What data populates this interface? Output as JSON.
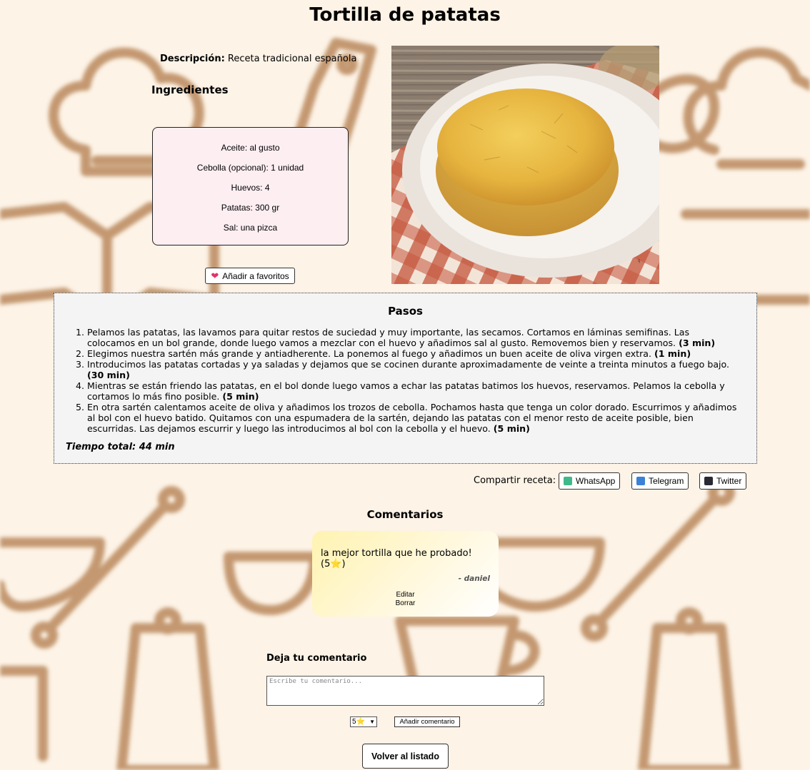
{
  "recipe": {
    "title": "Tortilla de patatas",
    "description_label": "Descripción:",
    "description": "Receta tradicional española",
    "ingredients_title": "Ingredientes",
    "ingredients": [
      "Aceite: al gusto",
      "Cebolla (opcional): 1 unidad",
      "Huevos: 4",
      "Patatas: 300 gr",
      "Sal: una pizca"
    ],
    "favorite_icon": "heart-icon",
    "favorite_label": "Añadir a favoritos"
  },
  "steps": {
    "title": "Pasos",
    "items": [
      {
        "text": "Pelamos las patatas, las lavamos para quitar restos de suciedad y muy importante, las secamos. Cortamos en láminas semifinas. Las colocamos en un bol grande, donde luego vamos a mezclar con el huevo y añadimos sal al gusto. Removemos bien y reservamos.",
        "time": "(3 min)"
      },
      {
        "text": "Elegimos nuestra sartén más grande y antiadherente. La ponemos al fuego y añadimos un buen aceite de oliva virgen extra.",
        "time": "(1 min)"
      },
      {
        "text": "Introducimos las patatas cortadas y ya saladas y dejamos que se cocinen durante aproximadamente de veinte a treinta minutos a fuego bajo.",
        "time": "(30 min)"
      },
      {
        "text": "Mientras se están friendo las patatas, en el bol donde luego vamos a echar las patatas batimos los huevos, reservamos. Pelamos la cebolla y cortamos lo más fino posible.",
        "time": "(5 min)"
      },
      {
        "text": "En otra sartén calentamos aceite de oliva y añadimos los trozos de cebolla. Pochamos hasta que tenga un color dorado. Escurrimos y añadimos al bol con el huevo batido. Quitamos con una espumadera de la sartén, dejando las patatas con el menor resto de aceite posible, bien escurridas. Las dejamos escurrir y luego las introducimos al bol con la cebolla y el huevo.",
        "time": "(5 min)"
      }
    ],
    "total_time": "Tiempo total: 44 min"
  },
  "share": {
    "label": "Compartir receta:",
    "buttons": [
      {
        "label": "WhatsApp",
        "color": "#3fb98a"
      },
      {
        "label": "Telegram",
        "color": "#3b82d6"
      },
      {
        "label": "Twitter",
        "color": "#2a2a35"
      }
    ]
  },
  "comments": {
    "title": "Comentarios",
    "items": [
      {
        "text": "la mejor tortilla que he probado! (5⭐)",
        "author": "- daniel",
        "edit_label": "Editar",
        "delete_label": "Borrar"
      }
    ],
    "form_title": "Deja tu comentario",
    "placeholder": "Escribe tu comentario...",
    "rating_value": "5⭐",
    "add_label": "Añadir comentario"
  },
  "nav": {
    "back_label": "Volver al listado"
  },
  "colors": {
    "background": "#fdf3e6",
    "ingredients_bg": "#fdeef2",
    "steps_bg": "#f4f4f4",
    "icon_brown": "#a0673a"
  }
}
